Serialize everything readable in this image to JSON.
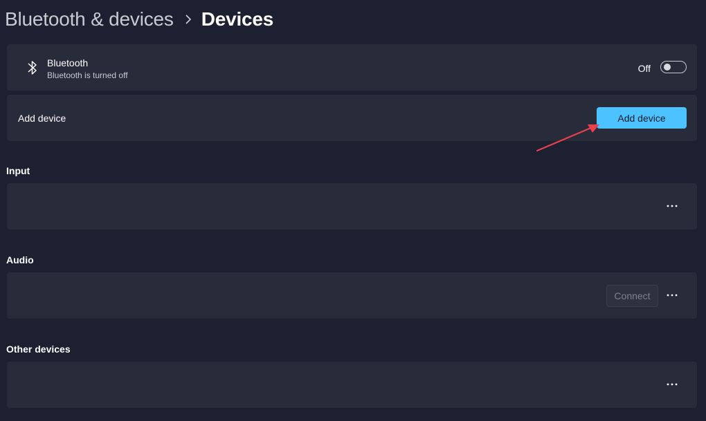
{
  "breadcrumb": {
    "parent": "Bluetooth & devices",
    "current": "Devices"
  },
  "bluetooth_card": {
    "icon": "bluetooth-icon",
    "title": "Bluetooth",
    "subtitle": "Bluetooth is turned off",
    "toggle_state_label": "Off",
    "toggle_on": false
  },
  "add_device_card": {
    "label": "Add device",
    "button_label": "Add device"
  },
  "sections": {
    "input": {
      "title": "Input"
    },
    "audio": {
      "title": "Audio",
      "connect_label": "Connect"
    },
    "other": {
      "title": "Other devices"
    }
  },
  "colors": {
    "background": "#1c2030",
    "card": "#272b3a",
    "accent": "#4cc2ff",
    "annotation_arrow": "#e8414c"
  }
}
